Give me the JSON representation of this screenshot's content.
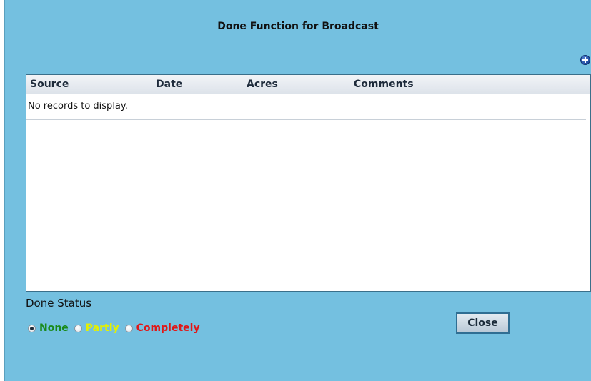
{
  "dialog": {
    "title": "Done Function for Broadcast",
    "add_icon": "add-circle-icon"
  },
  "grid": {
    "columns": [
      "Source",
      "Date",
      "Acres",
      "Comments"
    ],
    "empty_text": "No records to display."
  },
  "status": {
    "label": "Done Status",
    "options": [
      {
        "label": "None",
        "color": "#1a8a1a",
        "selected": true
      },
      {
        "label": "Partly",
        "color": "#e4f000",
        "selected": false
      },
      {
        "label": "Completely",
        "color": "#e01818",
        "selected": false
      }
    ]
  },
  "buttons": {
    "close_label": "Close"
  },
  "colors": {
    "dialog_bg": "#74c0e0",
    "grid_border": "#3a6f8a",
    "button_border": "#2f6e93"
  }
}
